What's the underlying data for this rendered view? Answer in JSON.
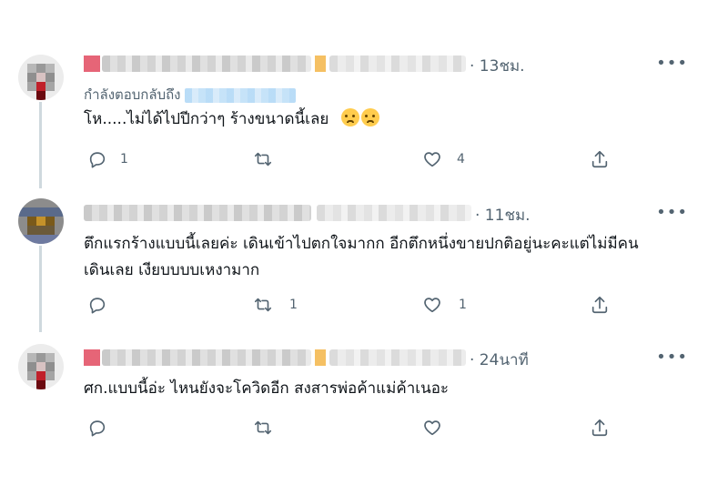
{
  "tweets": [
    {
      "time": "· 13ชม.",
      "replying_to": "กำลังตอบกลับถึง",
      "text": "โห.....ไม่ได้ไปปีกว่าๆ ร้างขนาดนี้เลย",
      "emoji": [
        "anxious-face",
        "anxious-face"
      ],
      "reply_count": "1",
      "retweet_count": "",
      "like_count": "4"
    },
    {
      "time": "· 11ชม.",
      "text_line1": "ตึกแรกร้างแบบนี้เลยค่ะ เดินเข้าไปตกใจมากก อีกตึกหนึ่งขายปกติอยู่นะคะแต่ไม่มีคน",
      "text_line2": "เดินเลย เงียบบบบเหงามาก",
      "reply_count": "",
      "retweet_count": "1",
      "like_count": "1"
    },
    {
      "time": "· 24นาที",
      "text": "ศก.แบบนี้อ่ะ ไหนยังจะโควิดอีก สงสารพ่อค้าแม่ค้าเนอะ",
      "reply_count": "",
      "retweet_count": "",
      "like_count": ""
    }
  ],
  "more_label": "•••",
  "colors": {
    "text": "#0f1419",
    "secondary": "#536471",
    "thread_line": "#cfd9de"
  }
}
